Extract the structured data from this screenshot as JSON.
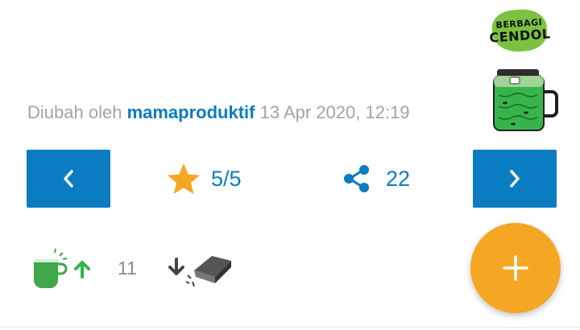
{
  "logo": {
    "line1": "BERBAGI",
    "line2": "CENDOL"
  },
  "article_meta": {
    "prefix": "Diubah oleh",
    "author": "mamaproduktif",
    "timestamp": "13 Apr 2020, 12:19"
  },
  "navigation": {
    "prev_icon": "‹",
    "next_icon": "›"
  },
  "rating": {
    "icon": "star-icon",
    "value": "5/5",
    "color": "#f5a623"
  },
  "share": {
    "icon": "share-icon",
    "count": "22"
  },
  "cendol": {
    "icon": "cendol-cup-up-icon",
    "count": "11"
  },
  "bata": {
    "icon": "bata-down-icon"
  },
  "fab": {
    "label": "+",
    "color": "#f5a623"
  },
  "colors": {
    "primary": "#0b7cc1",
    "muted": "#a3a3a3",
    "green": "#34b34a"
  }
}
